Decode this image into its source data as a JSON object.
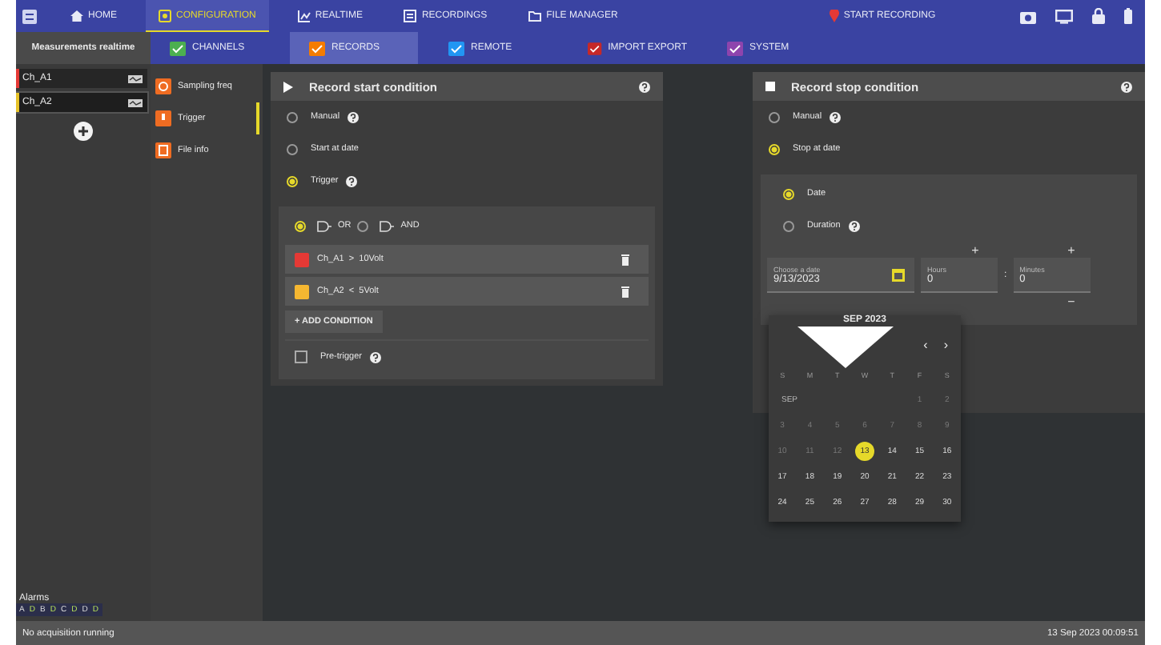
{
  "nav": {
    "tabs": [
      {
        "label": "HOME",
        "selected": false
      },
      {
        "label": "CONFIGURATION",
        "selected": true
      },
      {
        "label": "REALTIME",
        "selected": false
      },
      {
        "label": "RECORDINGS",
        "selected": false
      },
      {
        "label": "FILE MANAGER",
        "selected": false
      }
    ],
    "record_button": "START RECORDING"
  },
  "sidebar": {
    "title": "Measurements realtime",
    "channels": [
      {
        "name": "Ch_A1",
        "color": "#e53935",
        "selected": false
      },
      {
        "name": "Ch_A2",
        "color": "#e6c229",
        "selected": true
      }
    ],
    "alarms_label": "Alarms",
    "alarms": [
      {
        "label": "A",
        "on": false
      },
      {
        "label": "D",
        "on": true
      },
      {
        "label": "B",
        "on": false
      },
      {
        "label": "D",
        "on": true
      },
      {
        "label": "C",
        "on": false
      },
      {
        "label": "D",
        "on": true
      },
      {
        "label": "D",
        "on": false
      },
      {
        "label": "D",
        "on": true
      }
    ]
  },
  "subtabs": [
    {
      "label": "CHANNELS",
      "selected": false
    },
    {
      "label": "RECORDS",
      "selected": true
    },
    {
      "label": "REMOTE",
      "selected": false
    },
    {
      "label": "IMPORT EXPORT",
      "selected": false
    },
    {
      "label": "SYSTEM",
      "selected": false
    }
  ],
  "side_menu": [
    {
      "label": "Sampling freq",
      "selected": false
    },
    {
      "label": "Trigger",
      "selected": true
    },
    {
      "label": "File info",
      "selected": false
    }
  ],
  "start": {
    "title": "Record start condition",
    "options": [
      {
        "label": "Manual",
        "help": true,
        "selected": false
      },
      {
        "label": "Start at date",
        "help": false,
        "selected": false
      },
      {
        "label": "Trigger",
        "help": true,
        "selected": true
      }
    ],
    "logic": [
      {
        "label": "OR",
        "selected": true
      },
      {
        "label": "AND",
        "selected": false
      }
    ],
    "conditions": [
      {
        "text": "Ch_A1  >  10Volt",
        "color": "#e53935"
      },
      {
        "text": "Ch_A2  <  5Volt",
        "color": "#f5b731"
      }
    ],
    "add_button": "+ ADD CONDITION",
    "pretrigger": {
      "label": "Pre-trigger",
      "checked": false
    }
  },
  "stop": {
    "title": "Record stop condition",
    "options": [
      {
        "label": "Manual",
        "help": true,
        "selected": false
      },
      {
        "label": "Stop at date",
        "help": false,
        "selected": true
      }
    ],
    "modes": [
      {
        "label": "Date",
        "help": false,
        "selected": true
      },
      {
        "label": "Duration",
        "help": true,
        "selected": false
      }
    ],
    "date_field": {
      "label": "Choose a date",
      "value": "9/13/2023"
    },
    "hours": {
      "label": "Hours",
      "value": "0"
    },
    "minutes": {
      "label": "Minutes",
      "value": "0"
    },
    "plus": "+",
    "minus": "−",
    "separator": ":"
  },
  "calendar": {
    "title": "SEP 2023",
    "prev": "‹",
    "next": "›",
    "weekdays": [
      "S",
      "M",
      "T",
      "W",
      "T",
      "F",
      "S"
    ],
    "month_label": "SEP",
    "weeks": [
      [
        {
          "d": "1",
          "disabled": true,
          "selected": false
        },
        {
          "d": "2",
          "disabled": true,
          "selected": false
        }
      ],
      [
        {
          "d": "3",
          "disabled": true,
          "selected": false
        },
        {
          "d": "4",
          "disabled": true,
          "selected": false
        },
        {
          "d": "5",
          "disabled": true,
          "selected": false
        },
        {
          "d": "6",
          "disabled": true,
          "selected": false
        },
        {
          "d": "7",
          "disabled": true,
          "selected": false
        },
        {
          "d": "8",
          "disabled": true,
          "selected": false
        },
        {
          "d": "9",
          "disabled": true,
          "selected": false
        }
      ],
      [
        {
          "d": "10",
          "disabled": true,
          "selected": false
        },
        {
          "d": "11",
          "disabled": true,
          "selected": false
        },
        {
          "d": "12",
          "disabled": true,
          "selected": false
        },
        {
          "d": "13",
          "disabled": false,
          "selected": true
        },
        {
          "d": "14",
          "disabled": false,
          "selected": false
        },
        {
          "d": "15",
          "disabled": false,
          "selected": false
        },
        {
          "d": "16",
          "disabled": false,
          "selected": false
        }
      ],
      [
        {
          "d": "17",
          "disabled": false,
          "selected": false
        },
        {
          "d": "18",
          "disabled": false,
          "selected": false
        },
        {
          "d": "19",
          "disabled": false,
          "selected": false
        },
        {
          "d": "20",
          "disabled": false,
          "selected": false
        },
        {
          "d": "21",
          "disabled": false,
          "selected": false
        },
        {
          "d": "22",
          "disabled": false,
          "selected": false
        },
        {
          "d": "23",
          "disabled": false,
          "selected": false
        }
      ],
      [
        {
          "d": "24",
          "disabled": false,
          "selected": false
        },
        {
          "d": "25",
          "disabled": false,
          "selected": false
        },
        {
          "d": "26",
          "disabled": false,
          "selected": false
        },
        {
          "d": "27",
          "disabled": false,
          "selected": false
        },
        {
          "d": "28",
          "disabled": false,
          "selected": false
        },
        {
          "d": "29",
          "disabled": false,
          "selected": false
        },
        {
          "d": "30",
          "disabled": false,
          "selected": false
        }
      ]
    ]
  },
  "status": {
    "left": "No acquisition running",
    "right": "13 Sep 2023 00:09:51"
  }
}
